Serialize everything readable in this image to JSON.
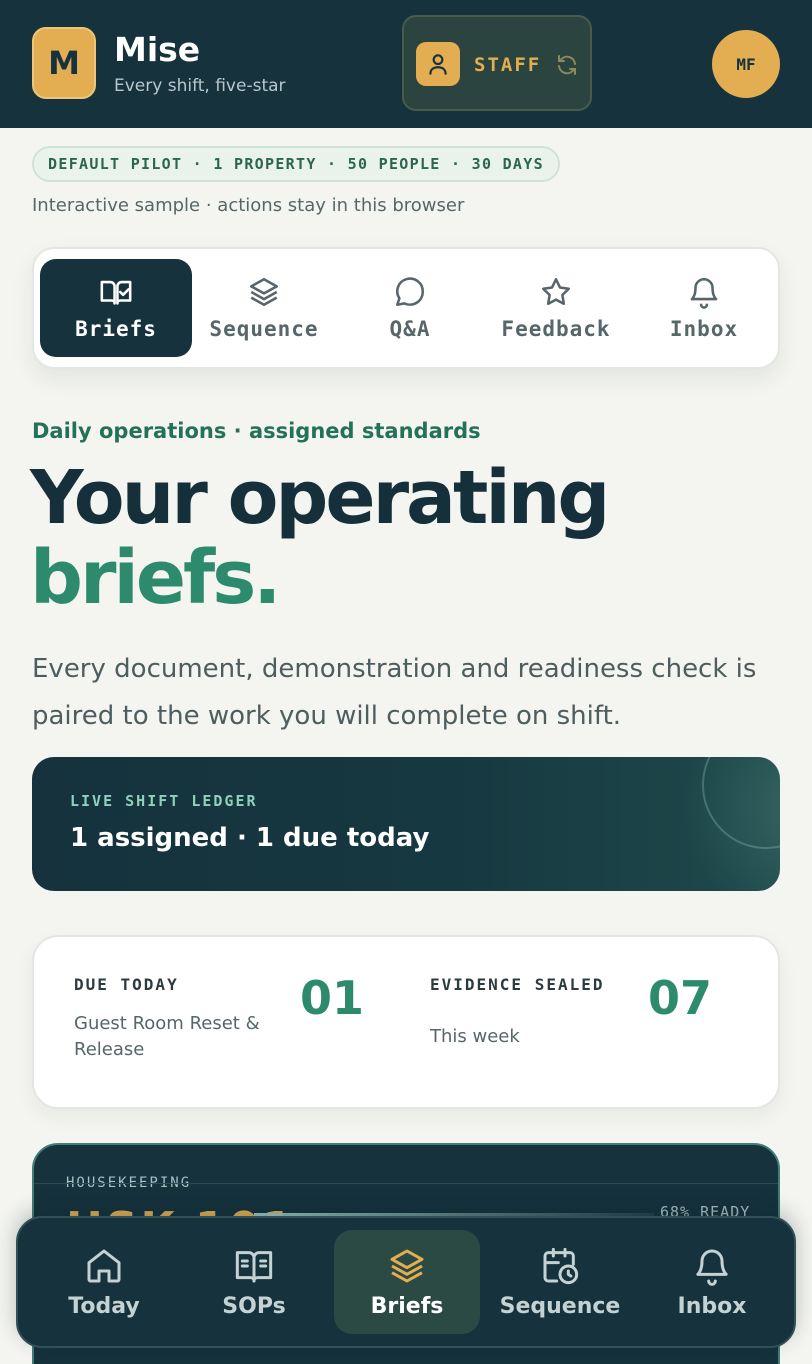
{
  "header": {
    "logo_letter": "M",
    "app_name": "Mise",
    "tagline": "Every shift, five-star",
    "role_label": "STAFF",
    "user_initials": "MF"
  },
  "pilot": {
    "summary": "DEFAULT PILOT · 1 PROPERTY · 50 PEOPLE · 30 DAYS",
    "note": "Interactive sample · actions stay in this browser"
  },
  "tabs": [
    {
      "label": "Briefs",
      "icon": "book-check-icon",
      "active": true
    },
    {
      "label": "Sequence",
      "icon": "layers-icon",
      "active": false
    },
    {
      "label": "Q&A",
      "icon": "chat-bubble-icon",
      "active": false
    },
    {
      "label": "Feedback",
      "icon": "star-icon",
      "active": false
    },
    {
      "label": "Inbox",
      "icon": "bell-icon",
      "active": false
    }
  ],
  "hero": {
    "eyebrow": "Daily operations · assigned standards",
    "title_line1": "Your operating",
    "title_line2": "briefs.",
    "body": "Every document, demonstration and readiness check is paired to the work you will complete on shift."
  },
  "ledger": {
    "kicker": "LIVE SHIFT LEDGER",
    "text": "1 assigned · 1 due today"
  },
  "stats": [
    {
      "kicker": "DUE TODAY",
      "sub": "Guest Room Reset & Release",
      "value": "01"
    },
    {
      "kicker": "EVIDENCE SEALED",
      "sub": "This week",
      "value": "07"
    }
  ],
  "brief": {
    "department": "HOUSEKEEPING",
    "code": "HSK-101",
    "ready": "68% READY",
    "ready_fraction": 0.68
  },
  "bottom_nav": [
    {
      "label": "Today",
      "icon": "home-icon",
      "active": false
    },
    {
      "label": "SOPs",
      "icon": "open-book-icon",
      "active": false
    },
    {
      "label": "Briefs",
      "icon": "layers-icon",
      "active": true
    },
    {
      "label": "Sequence",
      "icon": "calendar-clock-icon",
      "active": false
    },
    {
      "label": "Inbox",
      "icon": "bell-icon",
      "active": false
    }
  ],
  "colors": {
    "navy": "#15323d",
    "gold": "#e3ae52",
    "green": "#2e8a6d",
    "background": "#f4f5f0"
  }
}
